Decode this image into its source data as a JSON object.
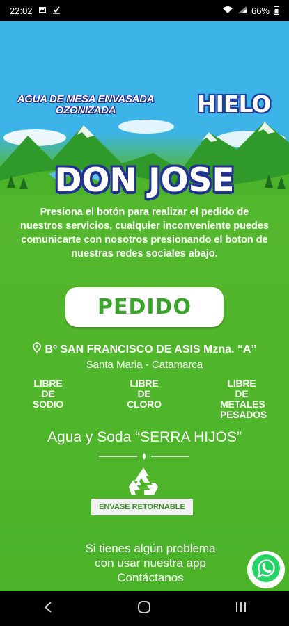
{
  "status_bar": {
    "time": "22:02",
    "battery": "66%",
    "icons": [
      "gallery-icon",
      "check-download-icon",
      "wifi-icon",
      "signal-icon",
      "battery-icon"
    ]
  },
  "header": {
    "tagline": "AGUA DE MESA ENVASADA OZONIZADA",
    "hielo": "HIELO",
    "brand": "DON JOSE"
  },
  "intro_text": "Presiona el botón para realizar el pedido de nuestros servicios, cualquier inconveniente puedes comunicarte con nosotros presionando el boton de nuestras redes sociales abajo.",
  "pedido_button": "PEDIDO",
  "address": {
    "line1": "Bº SAN FRANCISCO DE ASIS Mzna. “A”",
    "line2": "Santa Maria - Catamarca"
  },
  "features": [
    {
      "text": "LIBRE DE SODIO"
    },
    {
      "text": "LIBRE DE CLORO"
    },
    {
      "text": "LIBRE DE METALES PESADOS"
    }
  ],
  "company": "Agua y Soda “SERRA HIJOS”",
  "retornable_label": "ENVASE RETORNABLE",
  "support": {
    "line1": "Si tienes algún problema",
    "line2": "con usar nuestra app",
    "link": "Contáctanos"
  },
  "colors": {
    "sky": "#3cb4e8",
    "grass": "#4bb329",
    "accent_green": "#3aa32a",
    "outline_blue": "#23328f",
    "whatsapp_green": "#25d366"
  },
  "nav": [
    "back-icon",
    "home-icon",
    "recents-icon"
  ]
}
